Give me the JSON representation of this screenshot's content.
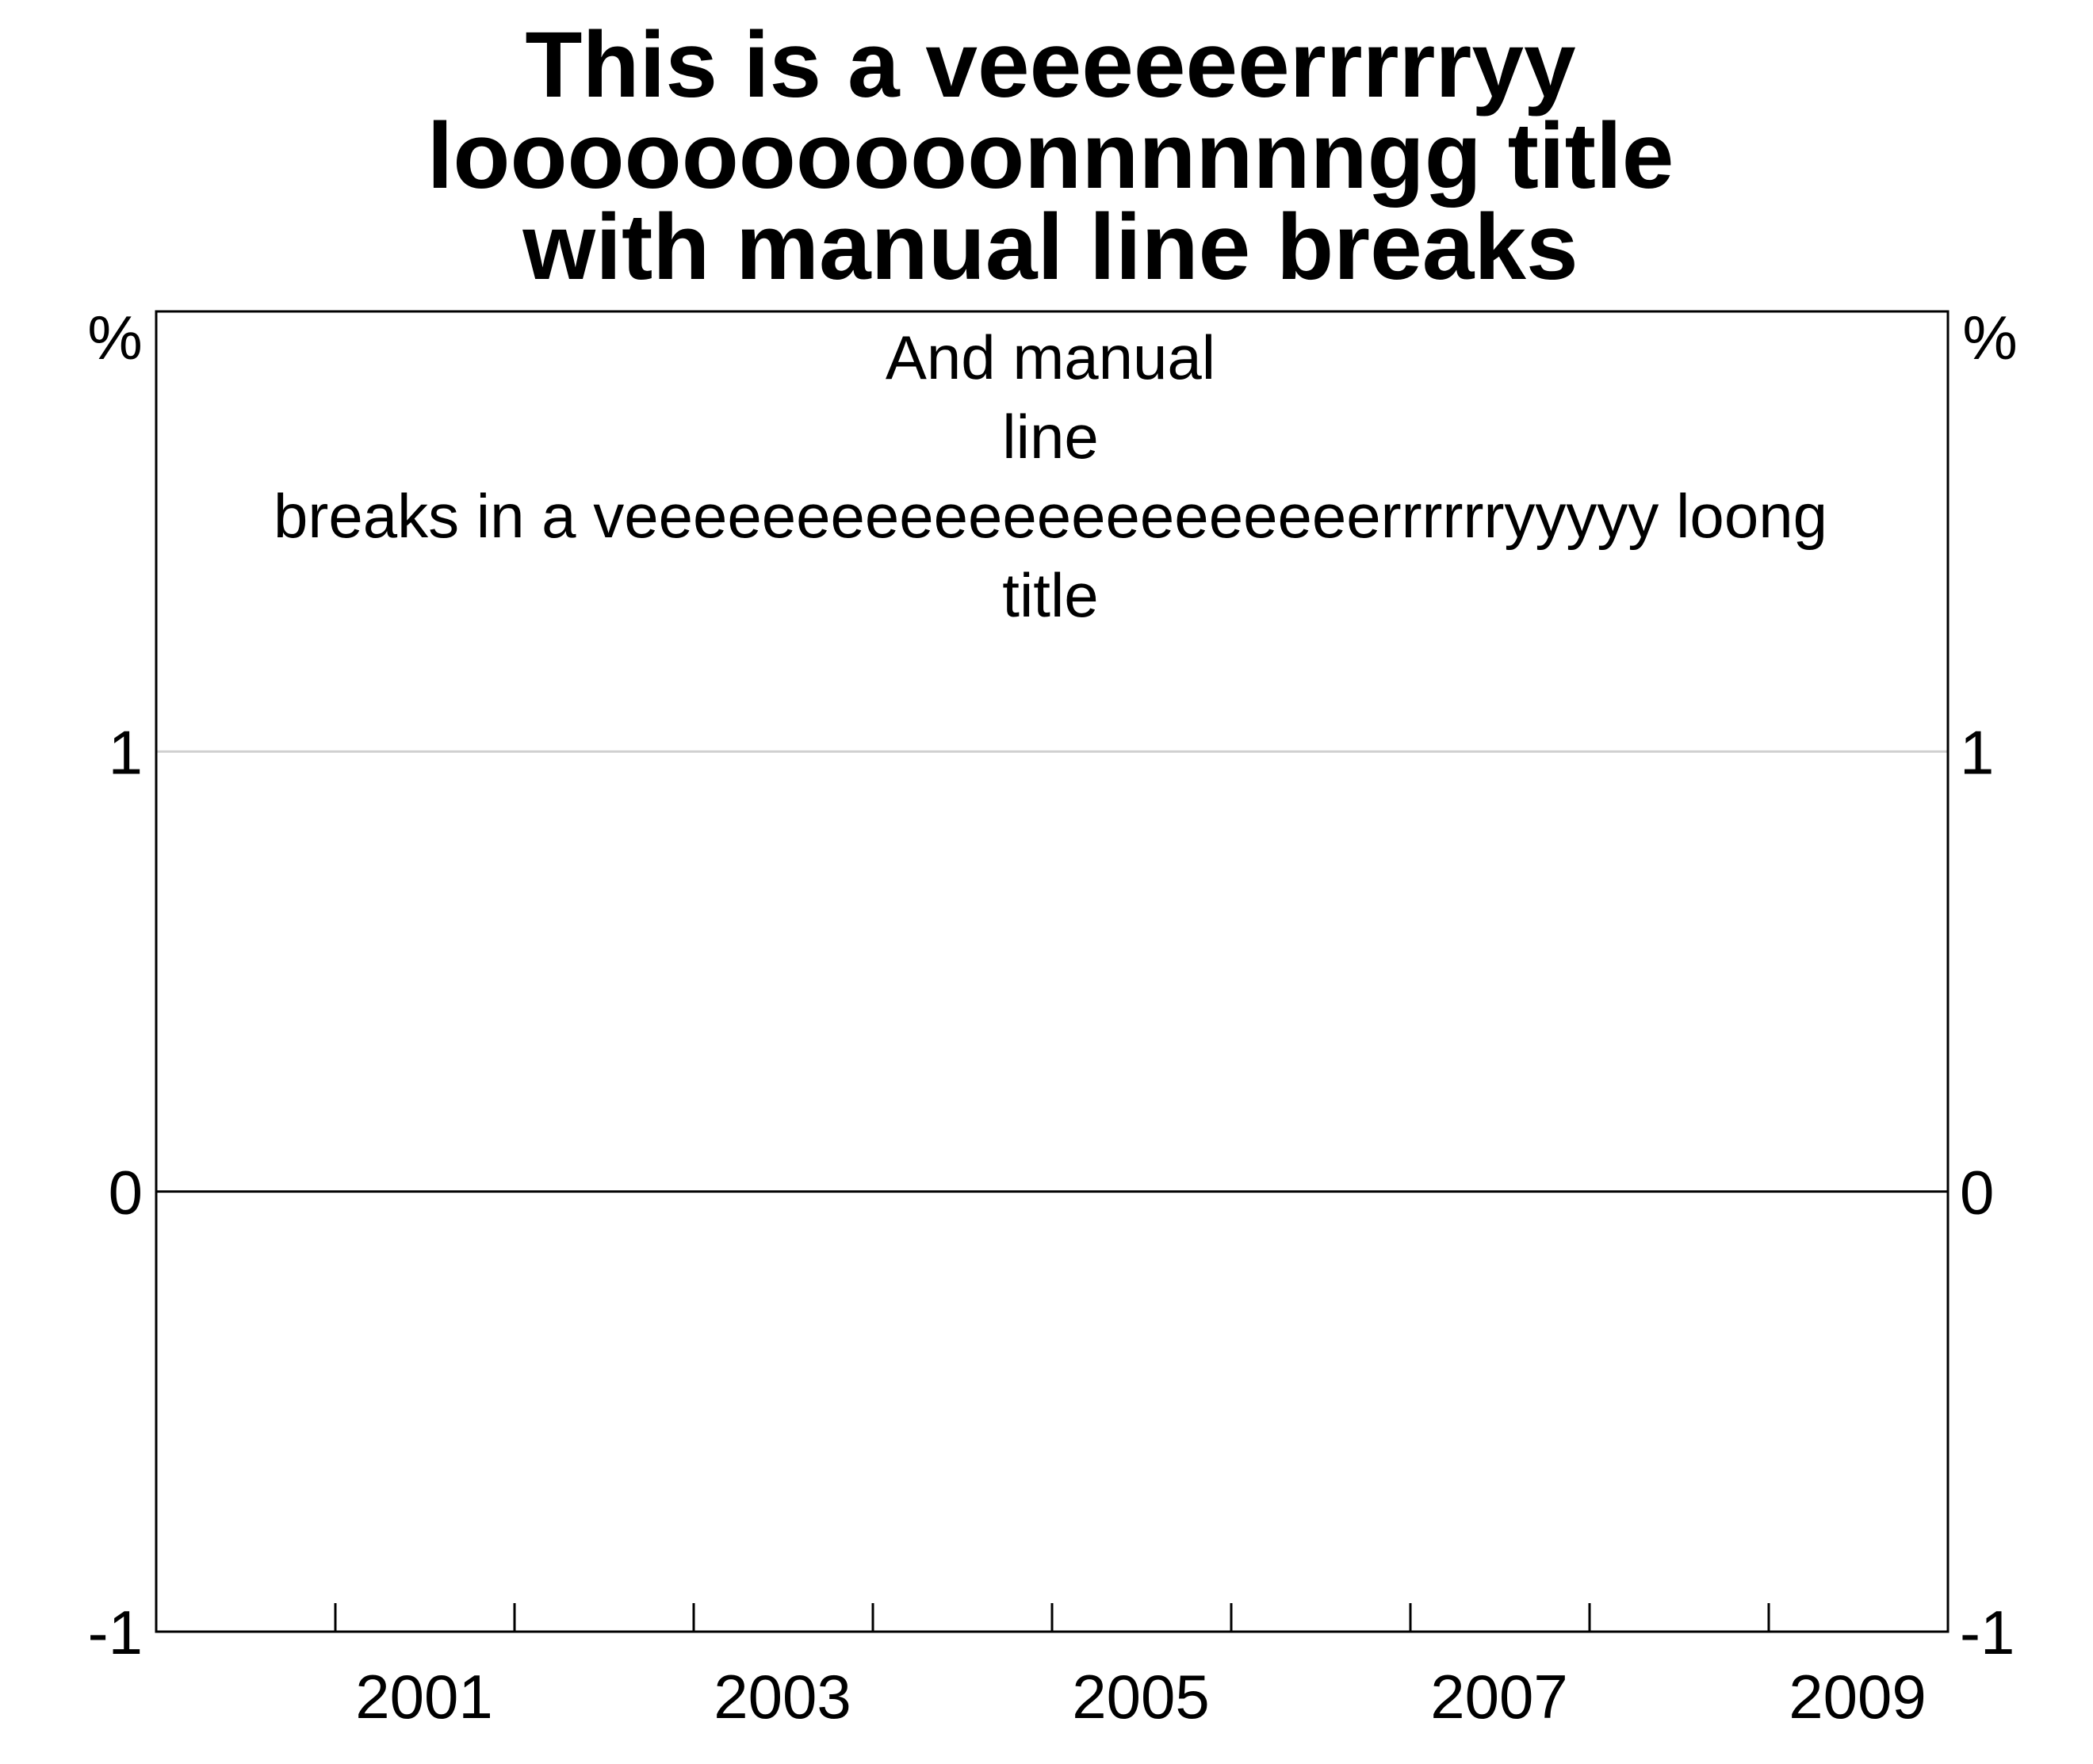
{
  "chart_data": {
    "type": "line",
    "title_lines": [
      "This is a veeeeeerrrrryy",
      "loooooooooonnnnnngg title",
      "with manual line breaks"
    ],
    "subtitle_lines": [
      "And manual",
      "line",
      "breaks in a veeeeeeeeeeeeeeeeeeeeeerrrrrryyyyy loong",
      "title"
    ],
    "left_unit": "%",
    "right_unit": "%",
    "ylim": [
      -1,
      2
    ],
    "yticks": [
      -1,
      0,
      1
    ],
    "ytick_labels": [
      "-1",
      "0",
      "1"
    ],
    "xlim": [
      2000,
      2010
    ],
    "x_minor_ticks": [
      2001,
      2002,
      2003,
      2004,
      2005,
      2006,
      2007,
      2008,
      2009
    ],
    "x_labels": [
      "2001",
      "2003",
      "2005",
      "2007",
      "2009"
    ],
    "x_label_positions": [
      2001,
      2003,
      2005,
      2007,
      2009
    ],
    "series": [],
    "zero_line": true,
    "grid": "horizontal"
  }
}
